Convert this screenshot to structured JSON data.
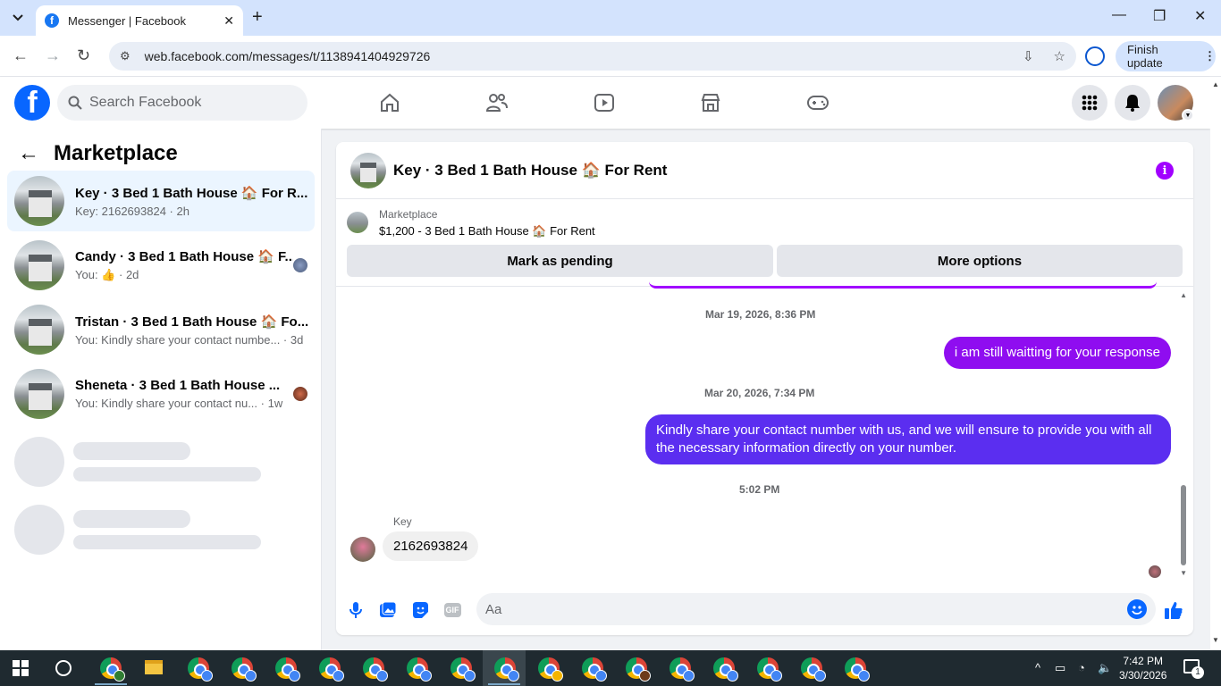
{
  "browser": {
    "tab_title": "Messenger | Facebook",
    "url": "web.facebook.com/messages/t/1138941404929726",
    "finish_update": "Finish update"
  },
  "header": {
    "search_placeholder": "Search Facebook"
  },
  "sidebar": {
    "title": "Marketplace",
    "conversations": [
      {
        "name": "Key · 3 Bed 1 Bath House 🏠 For R...",
        "preview": "Key: 2162693824 · 2h"
      },
      {
        "name": "Candy · 3 Bed 1 Bath House 🏠 F...",
        "preview_prefix": "You:",
        "preview_time": "· 2d"
      },
      {
        "name": "Tristan · 3 Bed 1 Bath House 🏠 Fo...",
        "preview": "You: Kindly share your contact numbe... · 3d"
      },
      {
        "name": "Sheneta · 3 Bed 1 Bath House ...",
        "preview": "You: Kindly share your contact nu...    · 1w"
      }
    ]
  },
  "chat": {
    "title": "Key · 3 Bed 1 Bath House 🏠 For Rent",
    "marketplace_label": "Marketplace",
    "listing": "$1,200 - 3 Bed 1 Bath House 🏠 For Rent",
    "mark_pending": "Mark as pending",
    "more_options": "More options",
    "info_icon": "i",
    "messages": [
      {
        "timestamp": "Mar 19, 2026, 8:36 PM",
        "text": "i am still waitting for your response"
      },
      {
        "timestamp": "Mar 20, 2026, 7:34 PM",
        "text": "Kindly share your contact number with us, and we will ensure to provide you with all the necessary information directly on your number."
      },
      {
        "timestamp": "5:02 PM",
        "sender": "Key",
        "text": "2162693824"
      }
    ],
    "composer_placeholder": "Aa",
    "gif_label": "GIF"
  },
  "taskbar": {
    "time": "7:42 PM",
    "date": "3/30/2026",
    "notifications": "1"
  },
  "colors": {
    "fb_blue": "#0866ff",
    "messenger_purple": "#a100ff",
    "bubble_gradient_top": "#8f0df0",
    "bubble_gradient_bottom": "#5b2ef0"
  }
}
